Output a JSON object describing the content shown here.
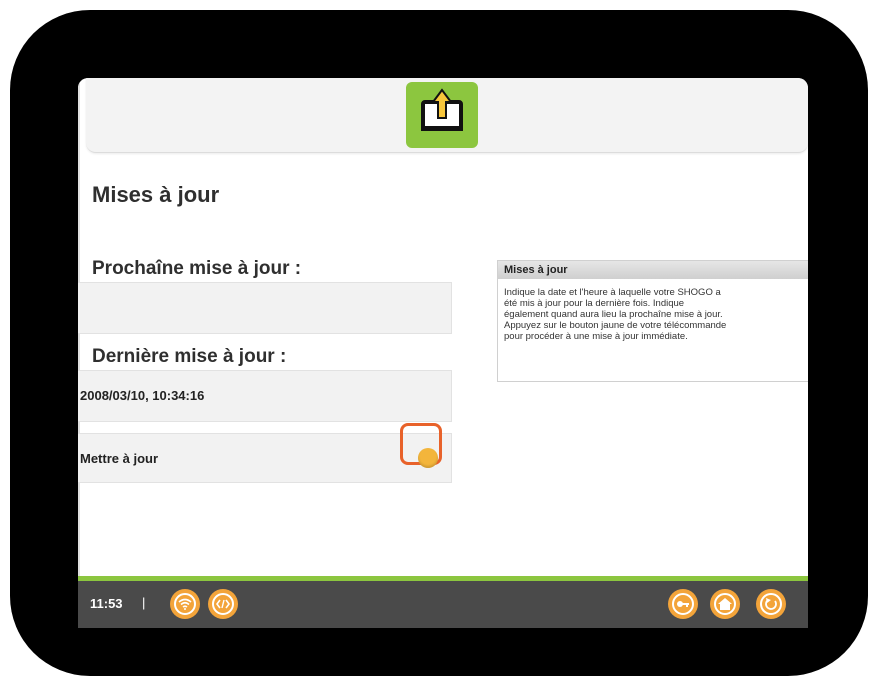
{
  "page": {
    "title": "Mises à jour"
  },
  "next_update": {
    "label": "Prochaîne mise à jour :",
    "value": ""
  },
  "last_update": {
    "label": "Dernière mise à jour :",
    "value": "2008/03/10, 10:34:16"
  },
  "action": {
    "label": "Mettre à jour",
    "button_color": "#f3b53b",
    "highlight_color": "#e8622a"
  },
  "help": {
    "title": "Mises à jour",
    "lines": [
      "Indique la date et l'heure à laquelle votre SHOGO a",
      "été mis à jour pour la dernière fois. Indique",
      "également quand aura lieu la prochaîne mise à jour.",
      "Appuyez sur le bouton jaune de votre télécommande",
      "pour procéder à une mise à jour immédiate."
    ]
  },
  "status_bar": {
    "time": "11:53",
    "separator": "|",
    "left_icons": [
      "wifi-icon",
      "code-icon"
    ],
    "right_icons": [
      "key-icon",
      "home-icon",
      "back-icon"
    ]
  },
  "colors": {
    "accent_green": "#8cc63f",
    "icon_orange": "#f3a43a",
    "bar_gray": "#4a4a4a"
  }
}
